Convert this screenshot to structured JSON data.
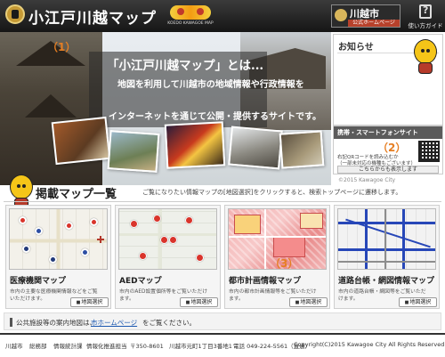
{
  "header": {
    "site_title": "小江戸川越マップ",
    "brand_text": "KOEDO KAWAGOE MAP",
    "city_name": "川越市",
    "city_sub": "公式ホームページ",
    "guide_label": "使い方ガイド"
  },
  "hero": {
    "title": "「小江戸川越マップ」とは...",
    "lines": [
      "地図を利用して川越市の地域情報や行政情報を",
      "インターネットを通じて公開・提供するサイトです。"
    ]
  },
  "news": {
    "title": "お知らせ",
    "marker": "（1）"
  },
  "mobile": {
    "title": "携帯・スマートフォンサイト",
    "marker": "（2）",
    "desc_lines": [
      "右記QRコードを読み込むか",
      "（一部未対応の機種もございます）"
    ],
    "button": "こちらからも表示します"
  },
  "copyright_note": "©2015 Kawagoe City",
  "map_list": {
    "title": "掲載マップ一覧",
    "instruction": "ご覧になりたい情報マップの[地図選択]をクリックすると、検索トップページに遷移します。",
    "marker": "（3）",
    "select_label": "地図選択",
    "cards": [
      {
        "title": "医療機関マップ",
        "desc_lines": [
          "市内の主要な医療機関情報などをご覧",
          "いただけます。"
        ]
      },
      {
        "title": "AEDマップ",
        "desc_lines": [
          "市内のAED設置個所等をご覧いただけ",
          "ます。"
        ]
      },
      {
        "title": "都市計画情報マップ",
        "desc_lines": [
          "市内の都市計画情報等をご覧いただけ",
          "ます。"
        ]
      },
      {
        "title": "道路台帳・網図情報マップ",
        "desc_lines": [
          "市内の道路台帳・網図等をご覧いただ",
          "けます。"
        ]
      }
    ]
  },
  "facility": {
    "text": "公共施設等の案内地図は、",
    "link": "市ホームページ",
    "text2": "をご覧ください。"
  },
  "footer": {
    "items": [
      "川越市",
      "総務部",
      "情報統計課",
      "情報化推進担当",
      "〒350-8601",
      "川越市元町1丁目3番地1",
      "電話 049-224-5561（直通）"
    ],
    "copyright": "Copyright(C)2015 Kawagoe City All Rights Reserved."
  },
  "colors": {
    "header_bg": "#1e1e1e",
    "marker": "#e67e22",
    "link": "#1a57b0",
    "accent_red": "#d9342b",
    "road_blue": "#2747b8"
  }
}
